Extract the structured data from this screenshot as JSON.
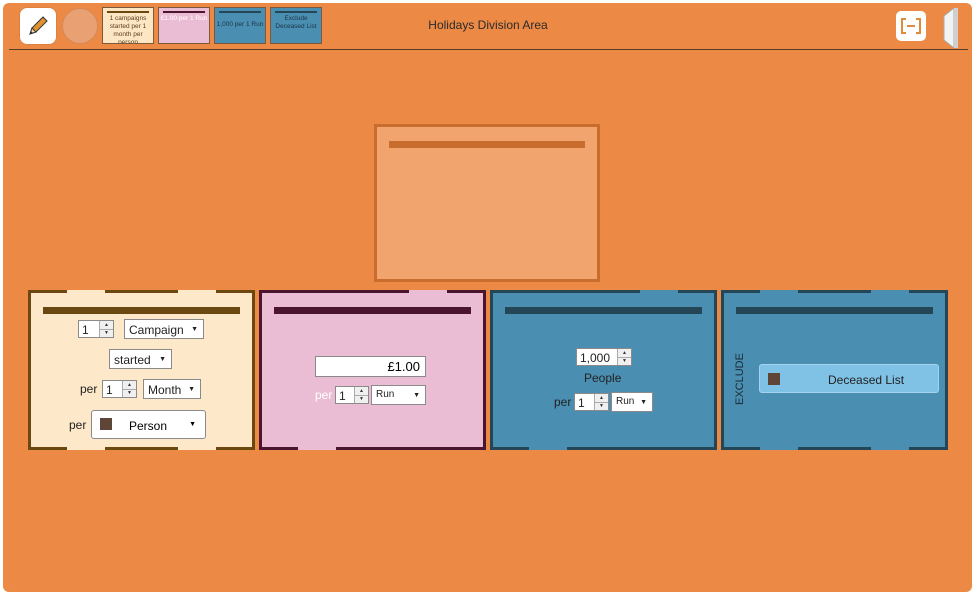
{
  "header": {
    "title": "Holidays Division Area",
    "thumbnails": [
      {
        "text": "1 campaigns started per 1 month per person"
      },
      {
        "text": "£1.00 per 1 Run"
      },
      {
        "text": "1,000 per 1 Run"
      },
      {
        "text": "Exclude Deceased List"
      }
    ]
  },
  "card_campaign": {
    "count": "1",
    "type": "Campaign",
    "status": "started",
    "per_label": "per",
    "period_count": "1",
    "period_unit": "Month",
    "per_label2": "per",
    "subject": "Person"
  },
  "card_money": {
    "amount": "£1.00",
    "per_label": "per",
    "count": "1",
    "unit": "Run"
  },
  "card_people": {
    "amount": "1,000",
    "label": "People",
    "per_label": "per",
    "count": "1",
    "unit": "Run"
  },
  "card_exclude": {
    "label": "EXCLUDE",
    "list": "Deceased List"
  },
  "colors": {
    "background": "#ec8944",
    "campaign": "#fde8c9",
    "money": "#ebbdd4",
    "people": "#4a8fb1",
    "exclude": "#4a8fb1"
  }
}
